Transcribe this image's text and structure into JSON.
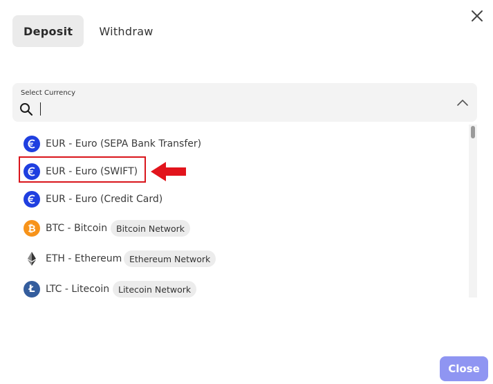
{
  "tabs": [
    {
      "label": "Deposit",
      "active": true
    },
    {
      "label": "Withdraw",
      "active": false
    }
  ],
  "select": {
    "label": "Select Currency",
    "value": "",
    "placeholder": ""
  },
  "currencies": [
    {
      "label": "EUR - Euro (SEPA Bank Transfer)",
      "icon": "euro-icon",
      "badge": ""
    },
    {
      "label": "EUR - Euro (SWIFT)",
      "icon": "euro-icon",
      "badge": ""
    },
    {
      "label": "EUR - Euro (Credit Card)",
      "icon": "euro-icon",
      "badge": ""
    },
    {
      "label": "BTC - Bitcoin",
      "icon": "bitcoin-icon",
      "badge": "Bitcoin Network"
    },
    {
      "label": "ETH - Ethereum",
      "icon": "ethereum-icon",
      "badge": "Ethereum Network"
    },
    {
      "label": "LTC - Litecoin",
      "icon": "litecoin-icon",
      "badge": "Litecoin Network"
    }
  ],
  "footer": {
    "close_label": "Close"
  },
  "colors": {
    "euro": "#1f3fe0",
    "bitcoin": "#f7931a",
    "litecoin": "#345d9d",
    "highlight": "#d9151b",
    "primary_button": "#8f95f2"
  }
}
